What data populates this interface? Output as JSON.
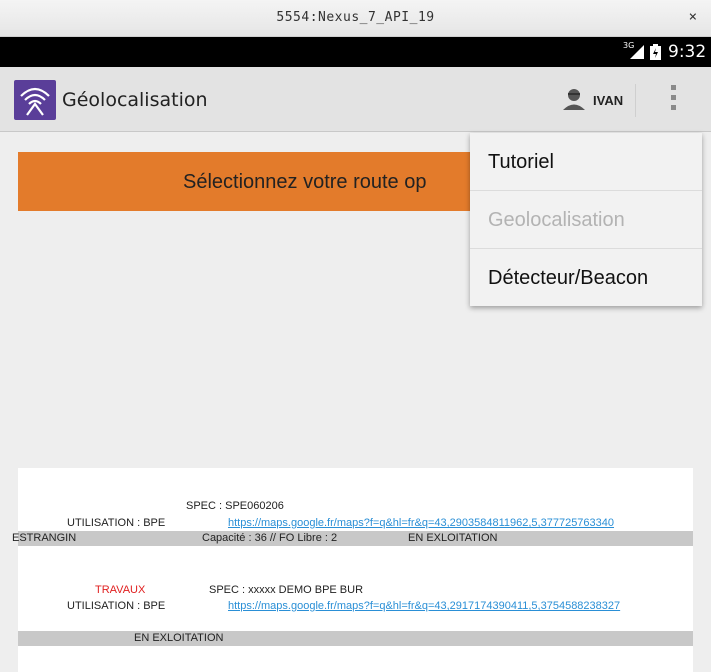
{
  "window": {
    "title": "5554:Nexus_7_API_19",
    "close_glyph": "×"
  },
  "status_bar": {
    "network": "3G",
    "time": "9:32"
  },
  "action_bar": {
    "title": "Géolocalisation",
    "user_name": "IVAN"
  },
  "banner": {
    "text": "Sélectionnez votre route op"
  },
  "menu": {
    "items": [
      {
        "label": "Tutoriel",
        "enabled": true
      },
      {
        "label": "Geolocalisation",
        "enabled": false
      },
      {
        "label": "Détecteur/Beacon",
        "enabled": true
      }
    ]
  },
  "list": {
    "item1": {
      "spec": "SPEC : SPE060206",
      "utilisation": "UTILISATION : BPE",
      "link": "https://maps.google.fr/maps?f=q&hl=fr&q=43,2903584811962,5,377725763340",
      "row": {
        "name": "ESTRANGIN",
        "capacity": "Capacité : 36 // FO Libre : 2",
        "status": "EN EXLOITATION"
      }
    },
    "item2": {
      "flag": "TRAVAUX",
      "spec": "SPEC : xxxxx DEMO BPE BUR",
      "utilisation": "UTILISATION : BPE",
      "link": "https://maps.google.fr/maps?f=q&hl=fr&q=43,2917174390411,5,3754588238327",
      "row": {
        "status": "EN EXLOITATION"
      }
    }
  },
  "colors": {
    "banner": "#e37b2b",
    "app_icon": "#5a3e99",
    "link": "#2a8fd6",
    "flag": "#e02020"
  }
}
